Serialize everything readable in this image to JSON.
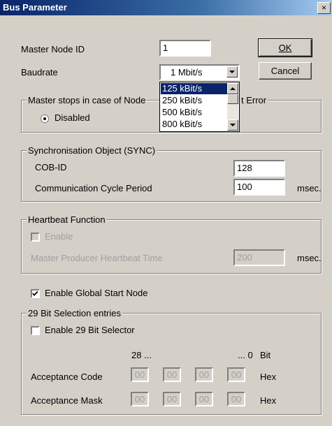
{
  "window": {
    "title": "Bus Parameter",
    "close_glyph": "×"
  },
  "master_node": {
    "label": "Master Node ID",
    "value": "1"
  },
  "baudrate": {
    "label": "Baudrate",
    "value": "1 Mbit/s",
    "options": [
      "125 kBit/s",
      "250 kBit/s",
      "500 kBit/s",
      "800 kBit/s"
    ],
    "highlighted_index": 0
  },
  "buttons": {
    "ok": "OK",
    "cancel": "Cancel"
  },
  "master_stops": {
    "title_left": "Master stops in case of Node",
    "title_right": "t Error",
    "radio_label": "Disabled",
    "radio_checked": true
  },
  "sync": {
    "title": "Synchronisation Object (SYNC)",
    "cob_label": "COB-ID",
    "cob_value": "128",
    "cycle_label": "Communication Cycle Period",
    "cycle_value": "100",
    "cycle_unit": "msec."
  },
  "heartbeat": {
    "title": "Heartbeat Function",
    "enable_label": "Enable",
    "enable_checked": false,
    "time_label": "Master Producer Heartbeat Time",
    "time_value": "200",
    "time_unit": "msec."
  },
  "global_start": {
    "label": "Enable Global Start Node",
    "checked": true
  },
  "bit29": {
    "title": "29 Bit Selection entries",
    "selector_label": "Enable 29 Bit Selector",
    "selector_checked": false,
    "col_left": "28 ...",
    "col_right": "... 0",
    "col_bit": "Bit",
    "acceptance_code_label": "Acceptance Code",
    "acceptance_code": [
      "00",
      "00",
      "00",
      "00"
    ],
    "acceptance_mask_label": "Acceptance Mask",
    "acceptance_mask": [
      "00",
      "00",
      "00",
      "00"
    ],
    "hex_unit": "Hex"
  },
  "colors": {
    "titlebar_start": "#0a246a",
    "titlebar_end": "#a6caf0",
    "face": "#d4d0c8",
    "selection": "#0a246a"
  }
}
